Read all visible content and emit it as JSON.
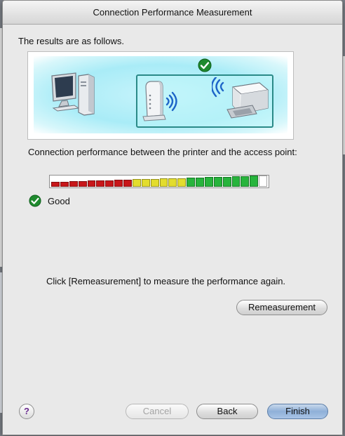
{
  "window": {
    "title": "Connection Performance Measurement"
  },
  "content": {
    "intro": "The results are as follows.",
    "performance_label": "Connection performance between the printer and the access point:",
    "status_text": "Good",
    "hint": "Click [Remeasurement] to measure the performance again."
  },
  "illustration": {
    "icons": [
      "computer-icon",
      "access-point-icon",
      "printer-icon",
      "check-icon"
    ]
  },
  "meter": {
    "total_segments": 24,
    "filled_segments": 23,
    "colors": {
      "red": "#c8171a",
      "yellow": "#e3dd2e",
      "green": "#27b43c",
      "empty": "#ffffff"
    }
  },
  "buttons": {
    "remeasure": "Remeasurement",
    "cancel": "Cancel",
    "back": "Back",
    "finish": "Finish",
    "help": "?"
  }
}
